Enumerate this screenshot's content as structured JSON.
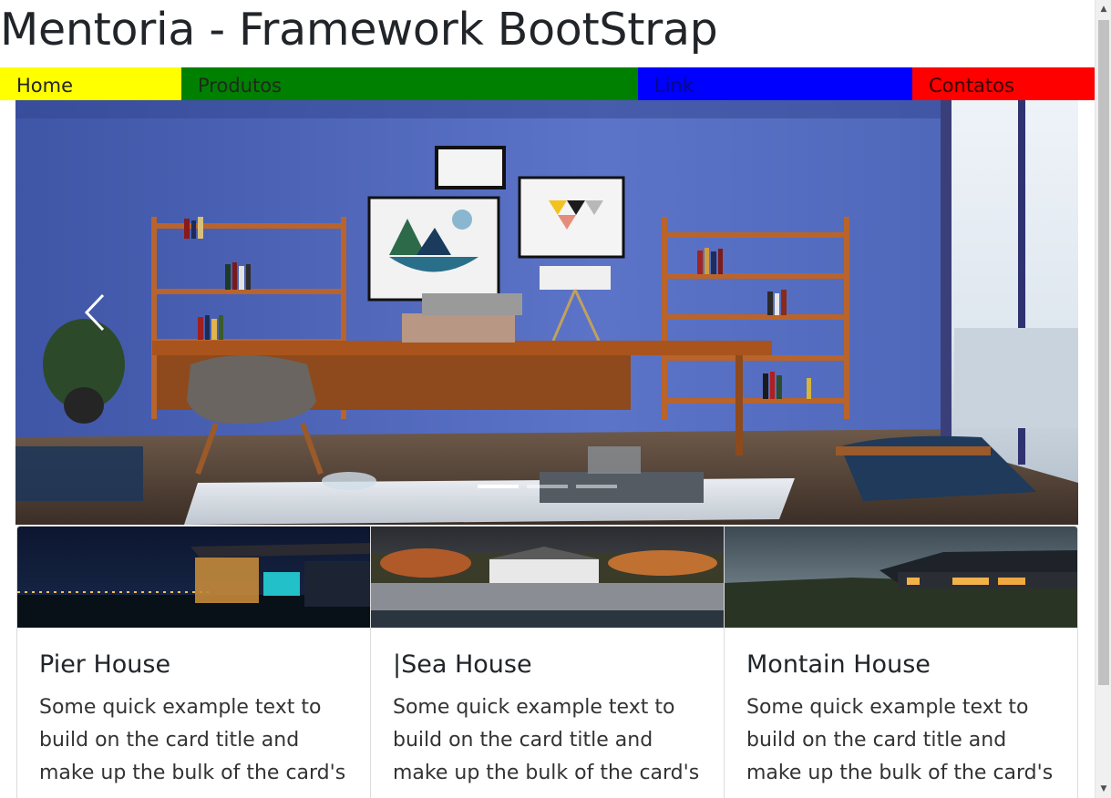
{
  "page": {
    "title": "Mentoria - Framework BootStrap"
  },
  "nav": {
    "items": [
      {
        "label": "Home",
        "color": "#ffff00"
      },
      {
        "label": "Produtos",
        "color": "#008000"
      },
      {
        "label": "Link",
        "color": "#0000ff"
      },
      {
        "label": "Contatos",
        "color": "#ff0000"
      }
    ]
  },
  "carousel": {
    "prev_icon": "chevron-left-icon",
    "active_slide": 1,
    "slide_count": 3
  },
  "cards": [
    {
      "title": "Pier House",
      "text": "Some quick example text to build on the card title and make up the bulk of the card's"
    },
    {
      "title": "|Sea House",
      "text": "Some quick example text to build on the card title and make up the bulk of the card's"
    },
    {
      "title": "Montain House",
      "text": "Some quick example text to build on the card title and make up the bulk of the card's"
    }
  ],
  "scrollbar": {
    "up_icon": "arrow-up-icon",
    "down_icon": "arrow-down-icon"
  }
}
